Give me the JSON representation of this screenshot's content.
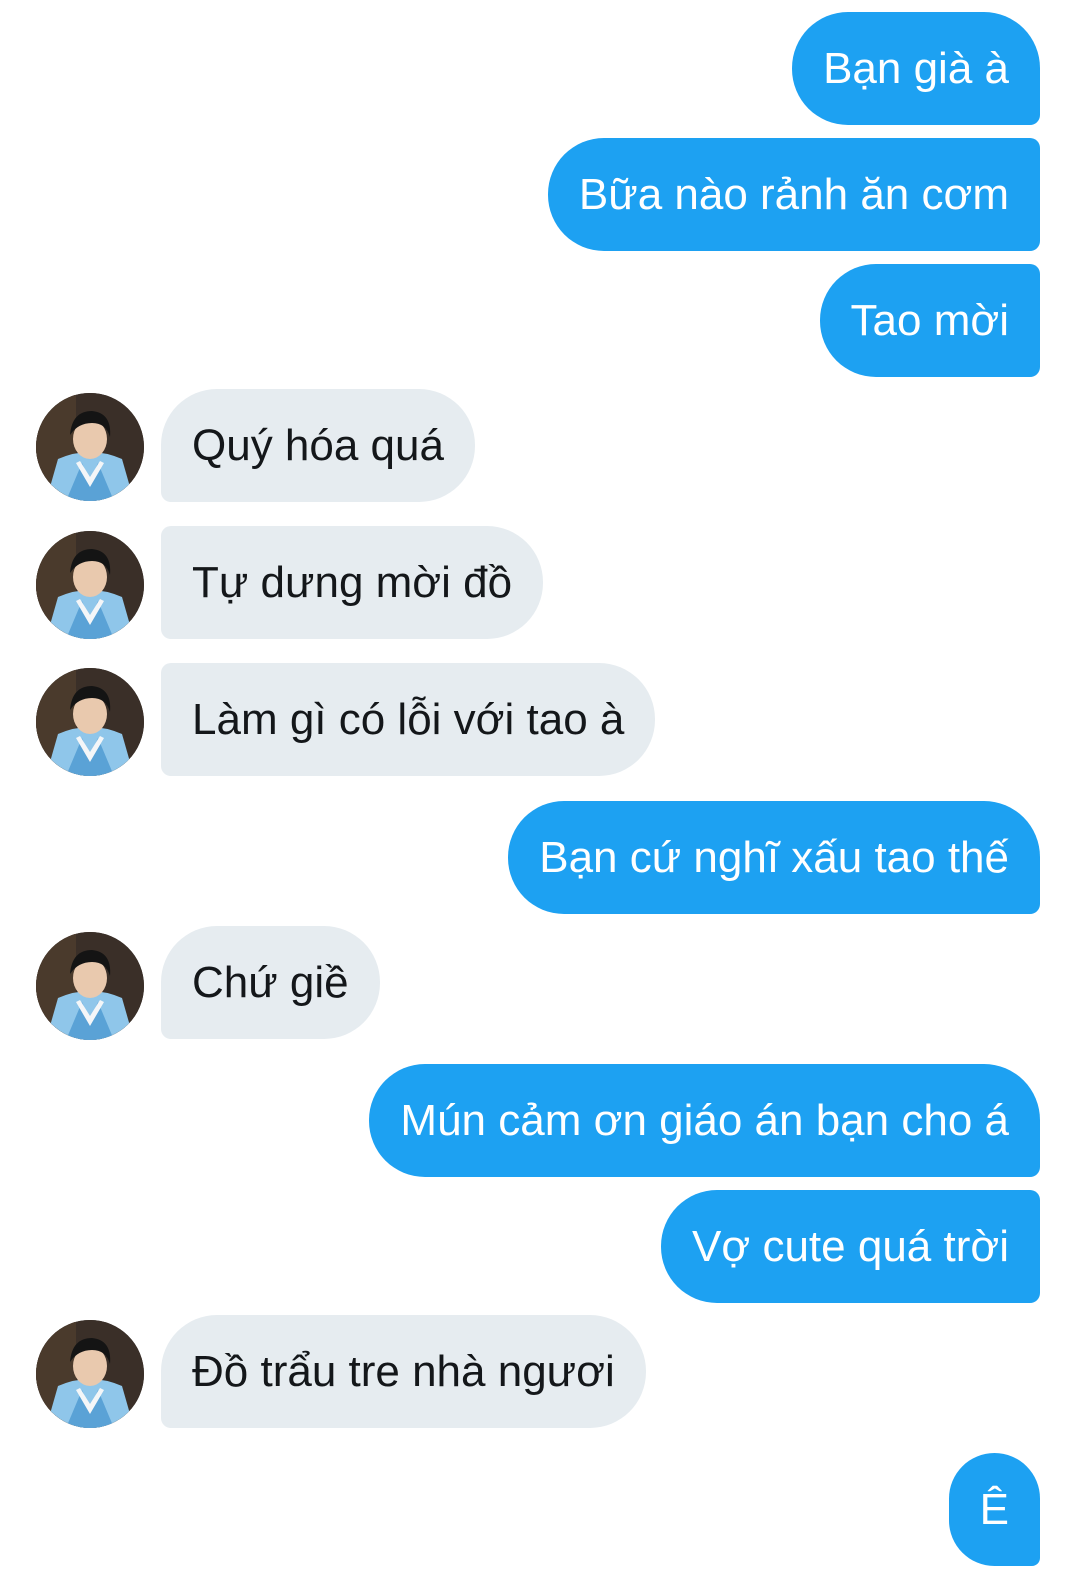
{
  "conversation": {
    "messages": [
      {
        "sender": "me",
        "text": "Bạn già à"
      },
      {
        "sender": "me",
        "text": "Bữa nào rảnh ăn cơm"
      },
      {
        "sender": "me",
        "text": "Tao mời"
      },
      {
        "sender": "them",
        "text": "Quý hóa quá"
      },
      {
        "sender": "them",
        "text": "Tự dưng mời đồ"
      },
      {
        "sender": "them",
        "text": "Làm gì có lỗi với tao à"
      },
      {
        "sender": "me",
        "text": "Bạn cứ nghĩ xấu tao thế"
      },
      {
        "sender": "them",
        "text": "Chứ giề"
      },
      {
        "sender": "me",
        "text": "Mún cảm ơn giáo án bạn cho á"
      },
      {
        "sender": "me",
        "text": "Vợ cute quá trời"
      },
      {
        "sender": "them",
        "text": "Đồ trẩu tre nhà ngươi"
      },
      {
        "sender": "me",
        "text": "Ê"
      }
    ]
  },
  "colors": {
    "outgoing_bubble": "#1da1f2",
    "incoming_bubble": "#e6ecf0",
    "outgoing_text": "#ffffff",
    "incoming_text": "#14171a"
  },
  "icons": {
    "avatar": "contact-avatar-photo"
  }
}
